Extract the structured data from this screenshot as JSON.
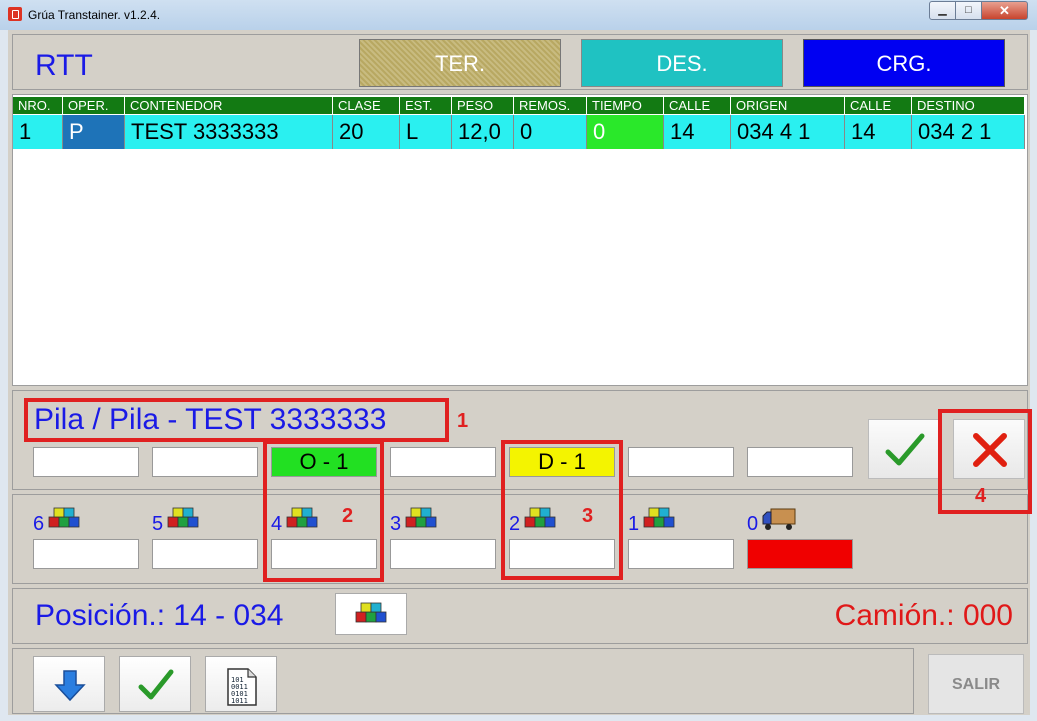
{
  "window": {
    "title": "Grúa Transtainer. v1.2.4.",
    "min_glyph": "▁",
    "max_glyph": "□",
    "close_glyph": "✕"
  },
  "header": {
    "app_label": "RTT",
    "tabs": [
      {
        "label": "TER.",
        "style": "patterned"
      },
      {
        "label": "DES.",
        "color": "#1fc2c2"
      },
      {
        "label": "CRG.",
        "color": "#0000f2"
      }
    ]
  },
  "table": {
    "columns": [
      "NRO.",
      "OPER.",
      "CONTENEDOR",
      "CLASE",
      "EST.",
      "PESO",
      "REMOS.",
      "TIEMPO",
      "CALLE",
      "ORIGEN",
      "CALLE",
      "DESTINO"
    ],
    "rows": [
      [
        "1",
        "P",
        "TEST 3333333",
        "20",
        "L",
        "12,0",
        "0",
        "0",
        "14",
        "034 4 1",
        "14",
        "034 2 1"
      ]
    ]
  },
  "pila": {
    "title": "Pila / Pila - TEST 3333333",
    "boxes": [
      "",
      "",
      "O - 1",
      "",
      "D - 1",
      "",
      ""
    ]
  },
  "levels": [
    {
      "num": "6",
      "icon": "container-stack-icon"
    },
    {
      "num": "5",
      "icon": "container-stack-icon"
    },
    {
      "num": "4",
      "icon": "container-stack-icon"
    },
    {
      "num": "3",
      "icon": "container-stack-icon"
    },
    {
      "num": "2",
      "icon": "container-stack-icon"
    },
    {
      "num": "1",
      "icon": "container-stack-icon"
    },
    {
      "num": "0",
      "icon": "truck-icon"
    }
  ],
  "position": {
    "label": "Posición.: 14 - 034",
    "truck": "Camión.: 000"
  },
  "actions": {
    "confirm_icon": "checkmark-icon",
    "cancel_icon": "red-x-icon",
    "salir_label": "SALIR"
  },
  "annotations": [
    "1",
    "2",
    "3",
    "4"
  ],
  "colors": {
    "accent_blue": "#1a1ae6",
    "header_green": "#137a13",
    "row_cyan": "#2af0f0",
    "origin_green": "#22e022",
    "dest_yellow": "#f4f400",
    "truck_red": "#f00000",
    "annotation_red": "#e02020"
  }
}
